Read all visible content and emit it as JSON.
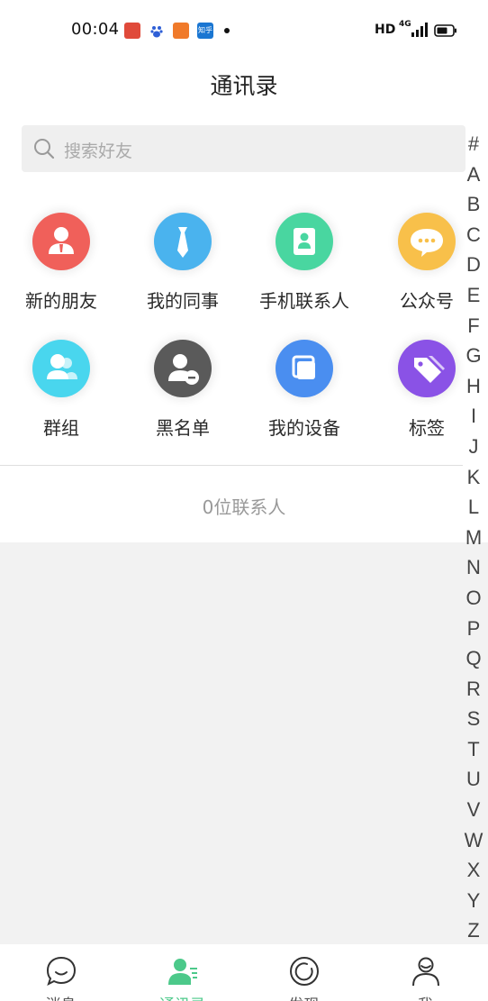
{
  "status_bar": {
    "time": "00:04",
    "apps": [
      {
        "icon": "app-red-icon",
        "text": "",
        "color": "#e04a3a"
      },
      {
        "icon": "baidu-icon",
        "text": "",
        "color": "#ffffff"
      },
      {
        "icon": "app-orange-icon",
        "text": "",
        "color": "#f07a2a"
      },
      {
        "icon": "zhihu-icon",
        "text": "知乎",
        "color": "#1a76d2"
      }
    ],
    "hd_label": "HD",
    "network_label": "4G"
  },
  "header": {
    "title": "通讯录"
  },
  "search": {
    "placeholder": "搜索好友"
  },
  "grid": {
    "items": [
      {
        "label": "新的朋友",
        "icon": "new-friend-icon",
        "color": "#f0605a"
      },
      {
        "label": "我的同事",
        "icon": "tie-icon",
        "color": "#4ab3ee"
      },
      {
        "label": "手机联系人",
        "icon": "phone-contact-icon",
        "color": "#49d6a0"
      },
      {
        "label": "公众号",
        "icon": "chat-bubble-icon",
        "color": "#f8c04a"
      },
      {
        "label": "群组",
        "icon": "group-icon",
        "color": "#49d6ee"
      },
      {
        "label": "黑名单",
        "icon": "blacklist-icon",
        "color": "#5a5a5a"
      },
      {
        "label": "我的设备",
        "icon": "device-icon",
        "color": "#4a8ef0"
      },
      {
        "label": "标签",
        "icon": "tag-icon",
        "color": "#8a52e6"
      }
    ]
  },
  "contact_count": "0位联系人",
  "alphabet": [
    "#",
    "A",
    "B",
    "C",
    "D",
    "E",
    "F",
    "G",
    "H",
    "I",
    "J",
    "K",
    "L",
    "M",
    "N",
    "O",
    "P",
    "Q",
    "R",
    "S",
    "T",
    "U",
    "V",
    "W",
    "X",
    "Y",
    "Z"
  ],
  "bottom_nav": {
    "items": [
      {
        "label": "消息",
        "icon": "message-icon",
        "active": false
      },
      {
        "label": "通讯录",
        "icon": "contacts-icon",
        "active": true
      },
      {
        "label": "发现",
        "icon": "discover-icon",
        "active": false
      },
      {
        "label": "我",
        "icon": "profile-icon",
        "active": false
      }
    ],
    "active_color": "#4cc98a"
  }
}
